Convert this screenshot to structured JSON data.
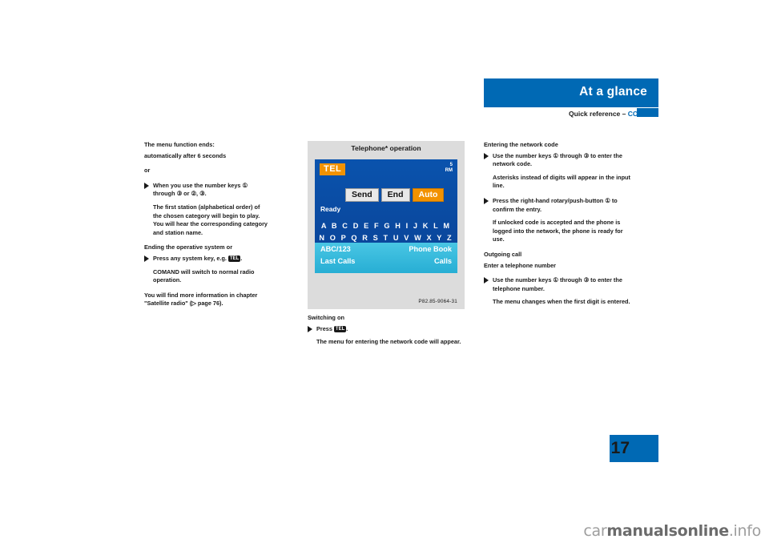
{
  "header": {
    "title": "At a glance",
    "subtitle_black": "Quick reference – ",
    "subtitle_blue": "COMAND"
  },
  "page_number": "17",
  "footer_watermark": {
    "part1": "car",
    "part2": "manualsonline",
    "part3": ".info"
  },
  "column1": {
    "heading1": "The menu function ends:",
    "para1": "automatically after 6 seconds",
    "para2": "or",
    "bullet1": "When you use the number keys ① through ③ or ②, ③.",
    "indent1": "The first station (alphabetical order) of the chosen category will begin to play. You will hear the corresponding category and station name.",
    "heading2": "Ending the operative system or",
    "bullet2": "Press any system key, e.g.",
    "bullet2_key": "TEL",
    "indent2": "COMAND will switch to normal radio operation.",
    "para3": "You will find more information in chapter \"Satellite radio\" (▷ page 76)."
  },
  "figure": {
    "title": "Telephone* operation",
    "tel_label": "TEL",
    "signal_line1": "5",
    "signal_line2": "RM",
    "softkeys": [
      "Send",
      "End",
      "Auto"
    ],
    "status": "Ready",
    "alphabet_row1": "A B C D E F G H I J K L M",
    "alphabet_row2": "N O P Q R S T U V W X Y Z",
    "bottom_left1": "ABC/123",
    "bottom_right1": "Phone Book",
    "bottom_left2": "Last Calls",
    "bottom_right2": "Calls",
    "code": "P82.85-9064-31"
  },
  "column2": {
    "heading1": "Switching on",
    "bullet1": "Press",
    "bullet1_key": "TEL",
    "indent1": "The menu for entering the network code will appear."
  },
  "column3": {
    "heading1": "Entering the network code",
    "bullet1": "Use the number keys ① through ③ to enter the network code.",
    "indent1": "Asterisks instead of digits will appear in the input line.",
    "bullet2": "Press the right-hand rotary/push-button ① to confirm the entry.",
    "indent2": "If unlocked code is accepted and the phone is logged into the network, the phone is ready for use.",
    "heading2": "Outgoing call",
    "subheading1": "Enter a telephone number",
    "bullet3": "Use the number keys ① through ③ to enter the telephone number.",
    "indent3": "The menu changes when the first digit is entered."
  }
}
